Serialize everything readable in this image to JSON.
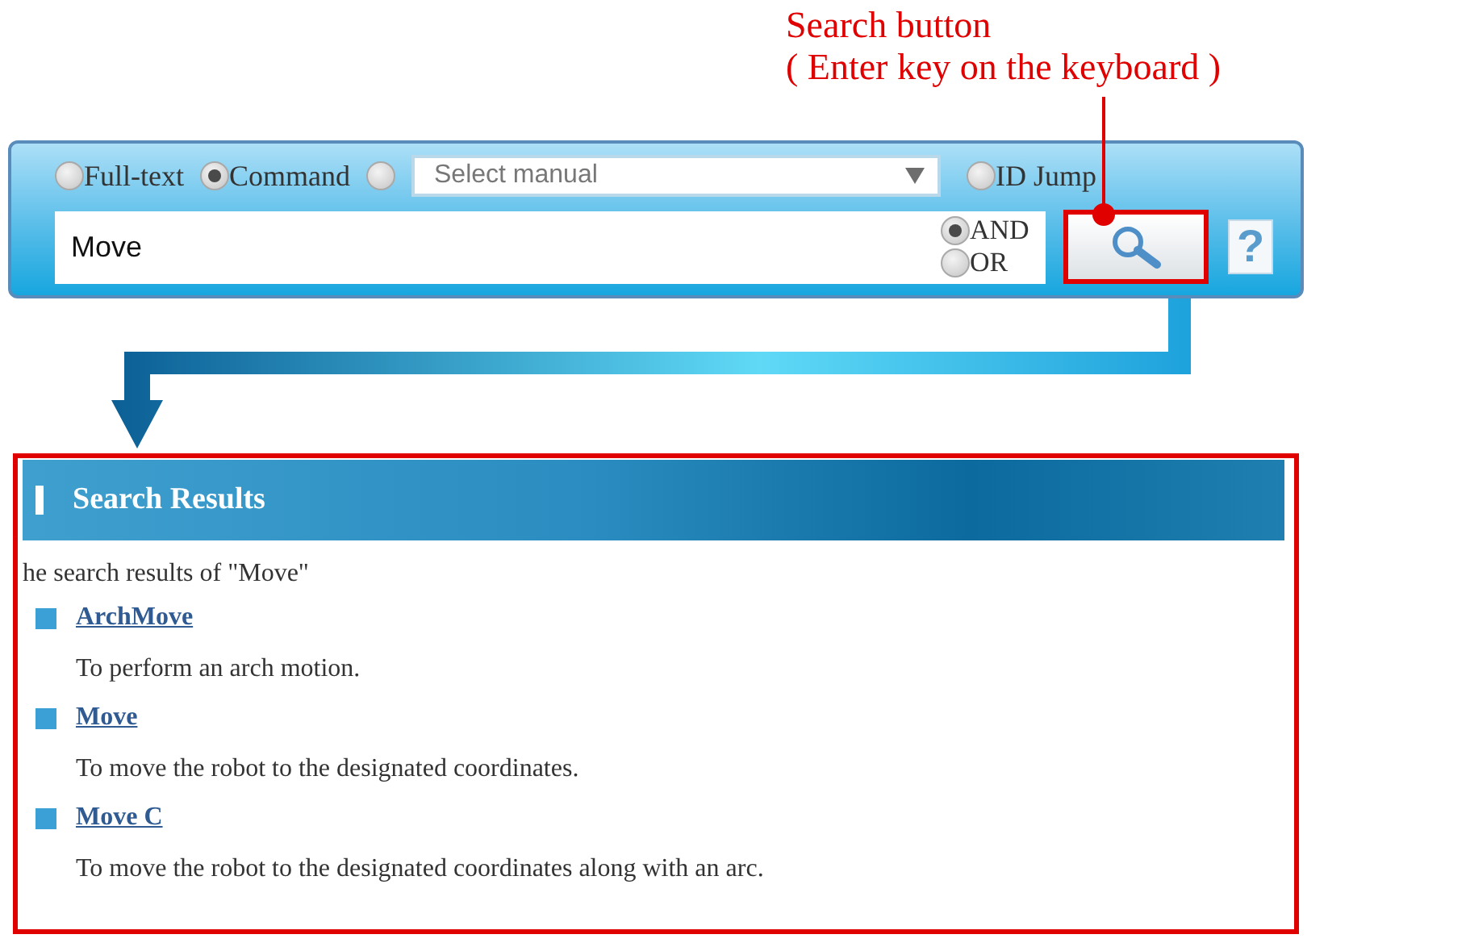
{
  "annotation": {
    "label": "Search button",
    "hint": "( Enter key on the keyboard )"
  },
  "search_panel": {
    "modes": [
      {
        "kind": "radio",
        "label": "Full-text",
        "selected": false
      },
      {
        "kind": "radio",
        "label": "Command",
        "selected": true
      },
      {
        "kind": "select",
        "value": "Select manual",
        "selected": false
      },
      {
        "kind": "radio",
        "label": "ID Jump",
        "selected": false
      }
    ],
    "query": "Move",
    "operators": [
      {
        "label": "AND",
        "selected": true
      },
      {
        "label": "OR",
        "selected": false
      }
    ],
    "search_button": {
      "highlighted": true
    },
    "help_button": {
      "label": "?"
    }
  },
  "results": {
    "title": "Search Results",
    "summary": "he search results of \"Move\"",
    "items": [
      {
        "title": "ArchMove",
        "description": "To perform an arch motion."
      },
      {
        "title": "Move",
        "description": "To move the robot to the designated coordinates."
      },
      {
        "title": "Move C",
        "description": "To move the robot to the designated coordinates along with an arc."
      }
    ]
  }
}
